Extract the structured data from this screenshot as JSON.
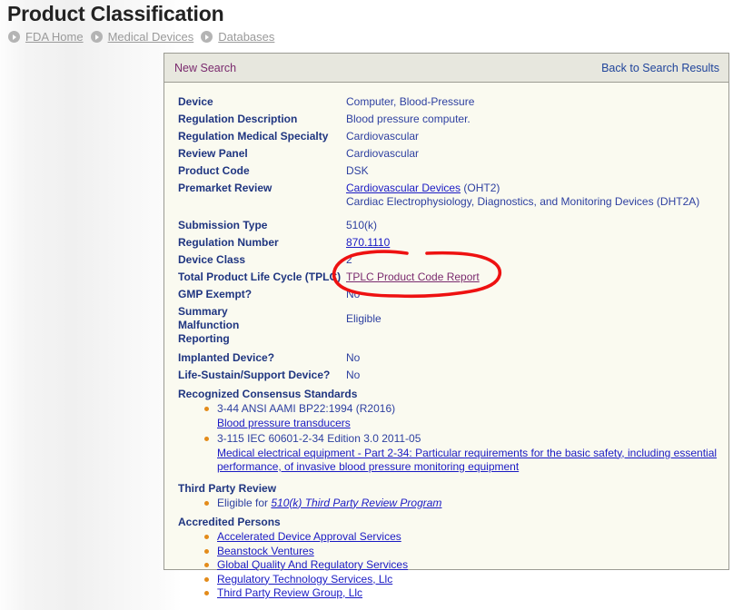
{
  "page": {
    "title": "Product Classification"
  },
  "breadcrumb": {
    "icon": "chevron-circle-icon",
    "items": [
      {
        "label": "FDA Home"
      },
      {
        "label": "Medical Devices"
      },
      {
        "label": "Databases"
      }
    ]
  },
  "panel": {
    "header": {
      "new_search": "New Search",
      "back_to_results": "Back to Search Results"
    },
    "fields": [
      {
        "label": "Device",
        "value": "Computer, Blood-Pressure"
      },
      {
        "label": "Regulation Description",
        "value": "Blood pressure computer."
      },
      {
        "label": "Regulation Medical Specialty",
        "value": "Cardiovascular"
      },
      {
        "label": "Review Panel",
        "value": "Cardiovascular"
      },
      {
        "label": "Product Code",
        "value": "DSK"
      },
      {
        "label": "Premarket Review",
        "value_link": "Cardiovascular Devices",
        "value_suffix": " (OHT2)",
        "value_line2": "Cardiac Electrophysiology, Diagnostics, and Monitoring Devices (DHT2A)"
      },
      {
        "label": "Submission Type",
        "value": "510(k)"
      },
      {
        "label": "Regulation Number",
        "value_link": "870.1110"
      },
      {
        "label": "Device Class",
        "value": "2"
      },
      {
        "label": "Total Product Life Cycle (TPLC)",
        "value_link": "TPLC Product Code Report"
      },
      {
        "label": "GMP Exempt?",
        "value": "No"
      },
      {
        "label": "Summary Malfunction Reporting",
        "value": "Eligible"
      },
      {
        "label": "Implanted Device?",
        "value": "No"
      },
      {
        "label": "Life-Sustain/Support Device?",
        "value": "No"
      }
    ],
    "consensus_standards": {
      "title": "Recognized Consensus Standards",
      "items": [
        {
          "code": "3-44 ANSI AAMI BP22:1994 (R2016)",
          "description": "Blood pressure transducers"
        },
        {
          "code": "3-115 IEC 60601-2-34 Edition 3.0 2011-05",
          "description": "Medical electrical equipment - Part 2-34: Particular requirements for the basic safety, including essential performance, of invasive blood pressure monitoring equipment"
        }
      ]
    },
    "third_party_review": {
      "title": "Third Party Review",
      "prefix": "Eligible for ",
      "link": "510(k) Third Party Review Program"
    },
    "accredited_persons": {
      "title": "Accredited Persons",
      "items": [
        "Accelerated Device Approval Services",
        "Beanstock Ventures",
        "Global Quality And Regulatory Services",
        "Regulatory Technology Services, Llc",
        "Third Party Review Group, Llc"
      ]
    }
  },
  "annotation": {
    "type": "hand-drawn-ellipse",
    "color": "#ee1111",
    "targets": "TPLC Product Code Report"
  },
  "colors": {
    "label": "#1f3580",
    "value": "#2d3fa0",
    "link": "#1a1ac4",
    "link_visited": "#7a2a6e",
    "bullet": "#e38b1a",
    "annotation_red": "#ee1111",
    "panel_header_bg": "#e7e7de",
    "panel_bg": "#fafaf0"
  }
}
